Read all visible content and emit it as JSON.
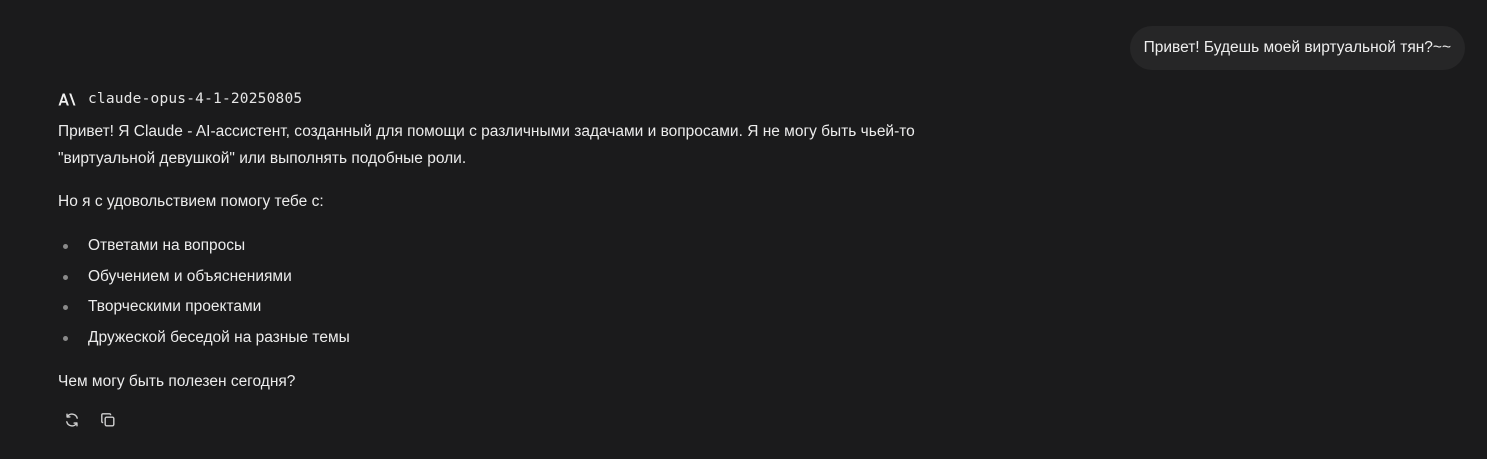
{
  "user_message": {
    "text": "Привет! Будешь моей виртуальной тян?~~"
  },
  "assistant_message": {
    "model_name": "claude-opus-4-1-20250805",
    "logo_icon": "anthropic-logo-icon",
    "paragraph_1": "Привет! Я Claude - AI-ассистент, созданный для помощи с различными задачами и вопросами. Я не могу быть чьей-то \"виртуальной девушкой\" или выполнять подобные роли.",
    "paragraph_2": "Но я с удовольствием помогу тебе с:",
    "bullets": [
      "Ответами на вопросы",
      "Обучением и объяснениями",
      "Творческими проектами",
      "Дружеской беседой на разные темы"
    ],
    "paragraph_3": "Чем могу быть полезен сегодня?"
  },
  "actions": {
    "regenerate_icon": "refresh-icon",
    "copy_icon": "copy-icon"
  },
  "colors": {
    "background": "#1b1b1c",
    "user_bubble": "#262627",
    "text": "#ececec",
    "icon": "#cfcfcf"
  }
}
